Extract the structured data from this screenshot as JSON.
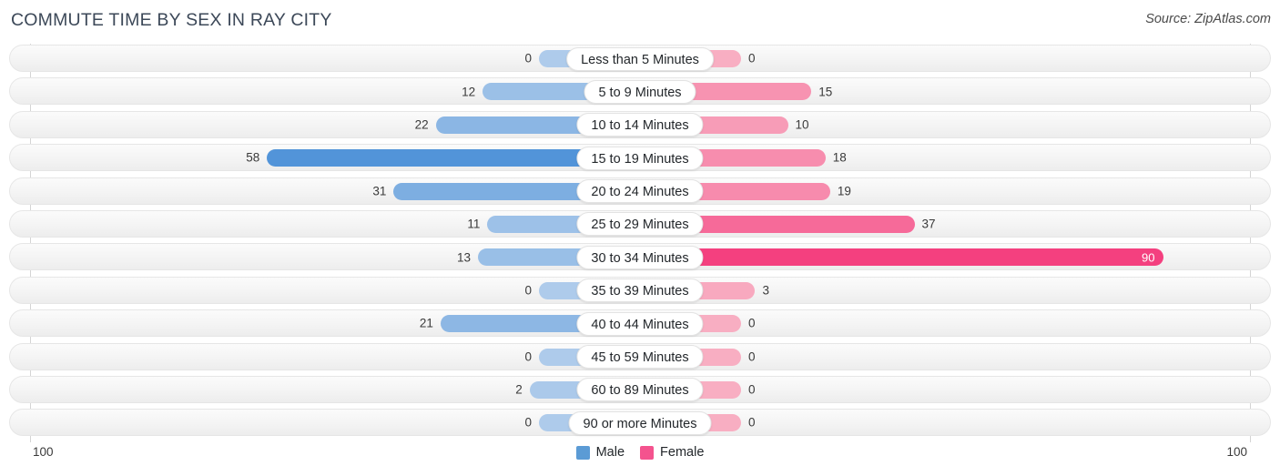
{
  "header": {
    "title": "COMMUTE TIME BY SEX IN RAY CITY",
    "source": "Source: ZipAtlas.com"
  },
  "axis": {
    "left_tick": "100",
    "right_tick": "100"
  },
  "legend": {
    "items": [
      {
        "label": "Male",
        "color": "#5B9BD5"
      },
      {
        "label": "Female",
        "color": "#F4538E"
      }
    ]
  },
  "chart_data": {
    "type": "bar",
    "orientation": "horizontal-diverging",
    "title": "COMMUTE TIME BY SEX IN RAY CITY",
    "xlabel": "",
    "ylabel": "",
    "xlim": [
      0,
      100
    ],
    "axis_max": 100,
    "grid": false,
    "legend_position": "bottom-center",
    "categories": [
      "Less than 5 Minutes",
      "5 to 9 Minutes",
      "10 to 14 Minutes",
      "15 to 19 Minutes",
      "20 to 24 Minutes",
      "25 to 29 Minutes",
      "30 to 34 Minutes",
      "35 to 39 Minutes",
      "40 to 44 Minutes",
      "45 to 59 Minutes",
      "60 to 89 Minutes",
      "90 or more Minutes"
    ],
    "series": [
      {
        "name": "Male",
        "color": "#5B9BD5",
        "values": [
          0,
          12,
          22,
          58,
          31,
          11,
          13,
          0,
          21,
          0,
          2,
          0
        ]
      },
      {
        "name": "Female",
        "color": "#F4538E",
        "values": [
          0,
          15,
          10,
          18,
          19,
          37,
          90,
          3,
          0,
          0,
          0,
          0
        ]
      }
    ]
  },
  "rows": [
    {
      "category": "Less than 5 Minutes",
      "male": "0",
      "female": "0"
    },
    {
      "category": "5 to 9 Minutes",
      "male": "12",
      "female": "15"
    },
    {
      "category": "10 to 14 Minutes",
      "male": "22",
      "female": "10"
    },
    {
      "category": "15 to 19 Minutes",
      "male": "58",
      "female": "18"
    },
    {
      "category": "20 to 24 Minutes",
      "male": "31",
      "female": "19"
    },
    {
      "category": "25 to 29 Minutes",
      "male": "11",
      "female": "37"
    },
    {
      "category": "30 to 34 Minutes",
      "male": "13",
      "female": "90"
    },
    {
      "category": "35 to 39 Minutes",
      "male": "0",
      "female": "3"
    },
    {
      "category": "40 to 44 Minutes",
      "male": "21",
      "female": "0"
    },
    {
      "category": "45 to 59 Minutes",
      "male": "0",
      "female": "0"
    },
    {
      "category": "60 to 89 Minutes",
      "male": "2",
      "female": "0"
    },
    {
      "category": "90 or more Minutes",
      "male": "0",
      "female": "0"
    }
  ]
}
